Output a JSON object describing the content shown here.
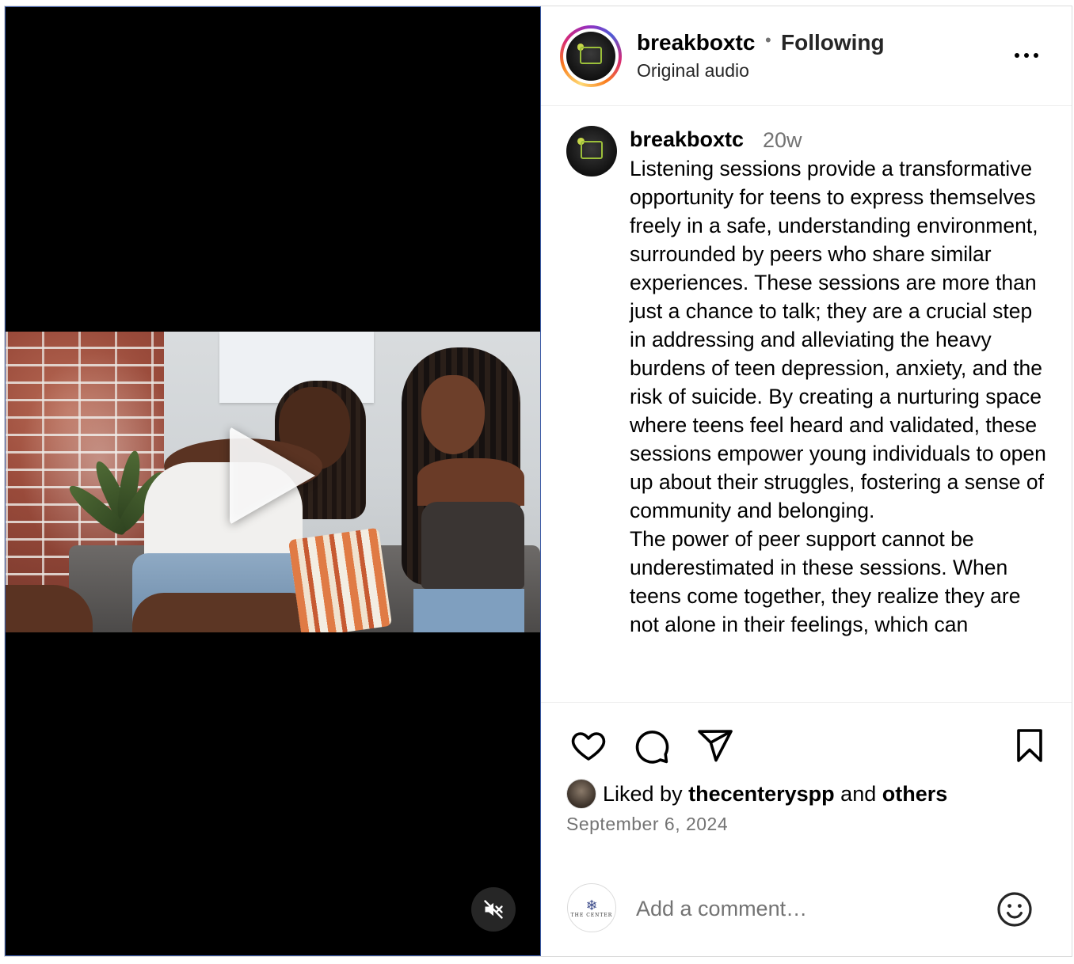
{
  "post": {
    "username": "breakboxtc",
    "follow_status": "Following",
    "separator": "•",
    "audio_label": "Original audio",
    "time_ago": "20w",
    "caption_paragraphs": [
      "Listening sessions provide a transformative opportunity for teens to express themselves freely in a safe, understanding environment, surrounded by peers who share similar experiences. These sessions are more than just a chance to talk; they are a crucial step in addressing and alleviating the heavy burdens of teen depression, anxiety, and the risk of suicide. By creating a nurturing space where teens feel heard and validated, these sessions empower young individuals to open up about their struggles, fostering a sense of community and belonging.",
      "The power of peer support cannot be underestimated in these sessions. When teens come together, they realize they are not alone in their feelings, which can"
    ],
    "liked_by_prefix": "Liked by",
    "liked_by_user": "thecenteryspp",
    "liked_by_and": "and",
    "liked_by_others": "others",
    "date": "September 6, 2024"
  },
  "video": {
    "playing": false,
    "muted": true
  },
  "comment": {
    "placeholder": "Add a comment…",
    "value": ""
  },
  "icons": {
    "like": "heart-icon",
    "comment": "comment-bubble-icon",
    "share": "paper-plane-icon",
    "save": "bookmark-icon",
    "more": "more-horizontal-icon",
    "mute": "speaker-muted-icon",
    "emoji": "smiley-icon",
    "play": "play-icon"
  },
  "colors": {
    "text_secondary": "#737373",
    "border": "#dbdbdb",
    "video_bg": "#000000"
  }
}
